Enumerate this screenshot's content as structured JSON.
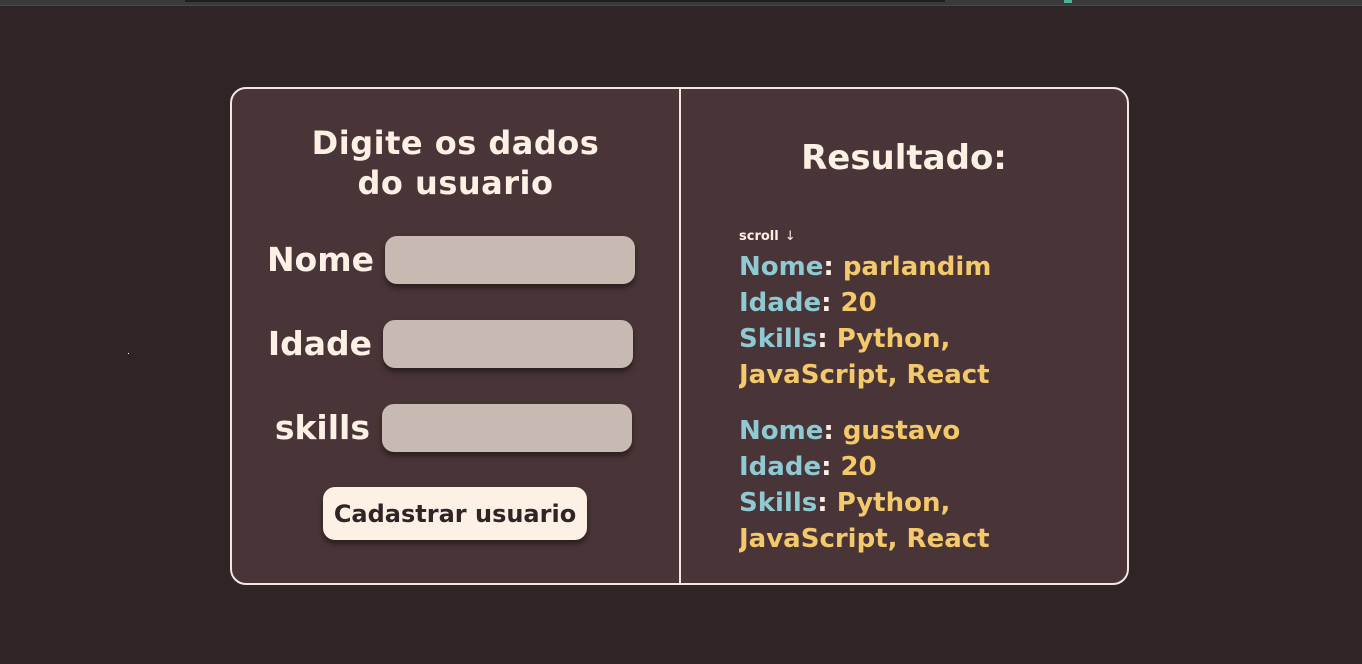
{
  "form": {
    "title_line1": "Digite os dados",
    "title_line2": "do usuario",
    "fields": [
      {
        "label": "Nome",
        "value": ""
      },
      {
        "label": "Idade",
        "value": ""
      },
      {
        "label": "skills",
        "value": ""
      }
    ],
    "submit_label": "Cadastrar usuario"
  },
  "result": {
    "title": "Resultado:",
    "scroll_hint": "scroll",
    "scroll_icon": "arrow-down-icon",
    "key_nome": "Nome",
    "key_idade": "Idade",
    "key_skills": "Skills",
    "entries": [
      {
        "nome": "parlandim",
        "idade": "20",
        "skills_line1": "Python,",
        "skills_line2": "JavaScript, React"
      },
      {
        "nome": "gustavo",
        "idade": "20",
        "skills_line1": "Python,",
        "skills_line2": "JavaScript, React"
      }
    ]
  },
  "colors": {
    "background": "#2f2426",
    "card": "#493537",
    "border": "#f3e7df",
    "text_light": "#fdf0e4",
    "input_bg": "#c8b9b2",
    "key_color": "#8fcad3",
    "value_color": "#f3c96b"
  }
}
